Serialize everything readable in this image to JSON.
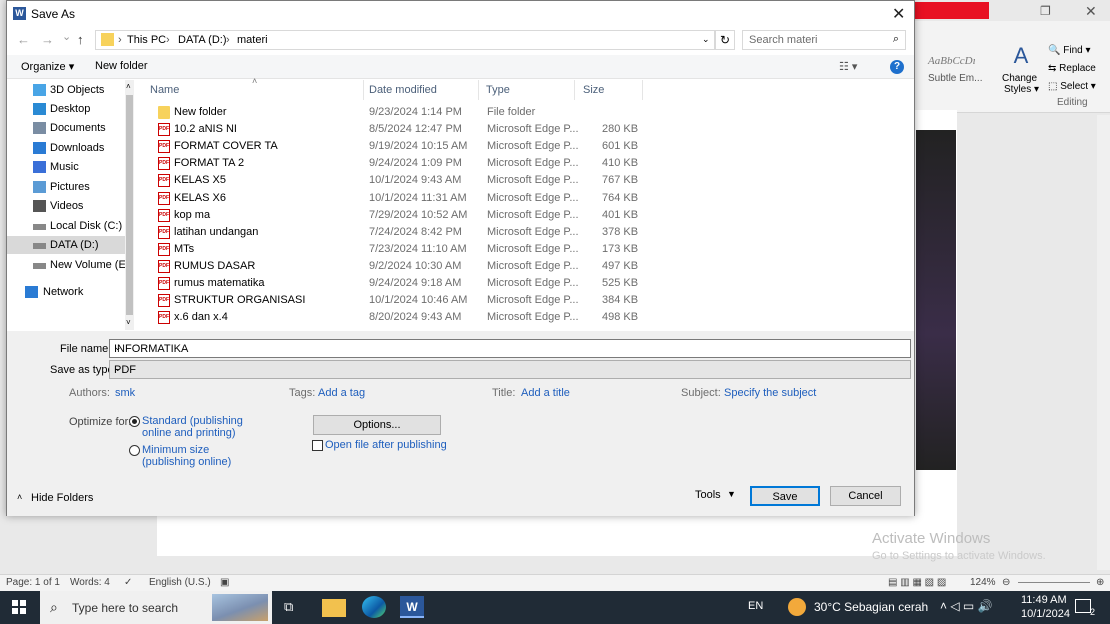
{
  "dialog": {
    "title": "Save As",
    "nav": {
      "back": "←",
      "forward": "→",
      "recent": "⌄",
      "up": "↑",
      "breadcrumb": [
        "This PC",
        "DATA (D:)",
        "materi"
      ],
      "separator": "›",
      "refresh": "↻",
      "search_placeholder": "Search materi"
    },
    "toolbar": {
      "organize": "Organize ▾",
      "new_folder": "New folder",
      "view": "☷ ▾",
      "help": "?"
    },
    "sidebar": [
      {
        "label": "3D Objects",
        "icon": "cube-icon",
        "selected": false
      },
      {
        "label": "Desktop",
        "icon": "desktop-icon",
        "selected": false
      },
      {
        "label": "Documents",
        "icon": "document-icon",
        "selected": false
      },
      {
        "label": "Downloads",
        "icon": "download-icon",
        "selected": false
      },
      {
        "label": "Music",
        "icon": "music-icon",
        "selected": false
      },
      {
        "label": "Pictures",
        "icon": "pictures-icon",
        "selected": false
      },
      {
        "label": "Videos",
        "icon": "video-icon",
        "selected": false
      },
      {
        "label": "Local Disk (C:)",
        "icon": "drive-icon",
        "selected": false
      },
      {
        "label": "DATA (D:)",
        "icon": "drive-icon",
        "selected": true
      },
      {
        "label": "New Volume (E:)",
        "icon": "drive-icon",
        "selected": false
      },
      {
        "label": "Network",
        "icon": "network-icon",
        "selected": false
      }
    ],
    "columns": [
      "Name",
      "Date modified",
      "Type",
      "Size"
    ],
    "files": [
      {
        "name": "New folder",
        "date": "9/23/2024 1:14 PM",
        "type": "File folder",
        "size": "",
        "icon": "folder-icon"
      },
      {
        "name": "10.2 aNIS NI",
        "date": "8/5/2024 12:47 PM",
        "type": "Microsoft Edge P...",
        "size": "280 KB",
        "icon": "pdf-icon"
      },
      {
        "name": "FORMAT COVER TA",
        "date": "9/19/2024 10:15 AM",
        "type": "Microsoft Edge P...",
        "size": "601 KB",
        "icon": "pdf-icon"
      },
      {
        "name": "FORMAT TA 2",
        "date": "9/24/2024 1:09 PM",
        "type": "Microsoft Edge P...",
        "size": "410 KB",
        "icon": "pdf-icon"
      },
      {
        "name": "KELAS X5",
        "date": "10/1/2024 9:43 AM",
        "type": "Microsoft Edge P...",
        "size": "767 KB",
        "icon": "pdf-icon"
      },
      {
        "name": "KELAS X6",
        "date": "10/1/2024 11:31 AM",
        "type": "Microsoft Edge P...",
        "size": "764 KB",
        "icon": "pdf-icon"
      },
      {
        "name": "kop ma",
        "date": "7/29/2024 10:52 AM",
        "type": "Microsoft Edge P...",
        "size": "401 KB",
        "icon": "pdf-icon"
      },
      {
        "name": "latihan undangan",
        "date": "7/24/2024 8:42 PM",
        "type": "Microsoft Edge P...",
        "size": "378 KB",
        "icon": "pdf-icon"
      },
      {
        "name": "MTs",
        "date": "7/23/2024 11:10 AM",
        "type": "Microsoft Edge P...",
        "size": "173 KB",
        "icon": "pdf-icon"
      },
      {
        "name": "RUMUS DASAR",
        "date": "9/2/2024 10:30 AM",
        "type": "Microsoft Edge P...",
        "size": "497 KB",
        "icon": "pdf-icon"
      },
      {
        "name": "rumus matematika",
        "date": "9/24/2024 9:18 AM",
        "type": "Microsoft Edge P...",
        "size": "525 KB",
        "icon": "pdf-icon"
      },
      {
        "name": "STRUKTUR ORGANISASI",
        "date": "10/1/2024 10:46 AM",
        "type": "Microsoft Edge P...",
        "size": "384 KB",
        "icon": "pdf-icon"
      },
      {
        "name": "x.6 dan x.4",
        "date": "8/20/2024 9:43 AM",
        "type": "Microsoft Edge P...",
        "size": "498 KB",
        "icon": "pdf-icon"
      }
    ],
    "form": {
      "file_name_label": "File name:",
      "file_name_value": "INFORMATIKA",
      "save_type_label": "Save as type:",
      "save_type_value": "PDF",
      "authors_label": "Authors:",
      "authors_value": "smk",
      "tags_label": "Tags:",
      "tags_value": "Add a tag",
      "title_label": "Title:",
      "title_value": "Add a title",
      "subject_label": "Subject:",
      "subject_value": "Specify the subject",
      "optimize_label": "Optimize for:",
      "opt_standard_1": "Standard (publishing",
      "opt_standard_2": "online and printing)",
      "opt_minimum_1": "Minimum size",
      "opt_minimum_2": "(publishing online)",
      "options_button": "Options...",
      "open_after": "Open file after publishing",
      "hide_folders": "Hide Folders",
      "tools": "Tools",
      "save": "Save",
      "cancel": "Cancel"
    }
  },
  "word": {
    "ribbon": {
      "style_preview": "AaBbCcDı",
      "style_name": "Subtle Em...",
      "change_styles_1": "Change",
      "change_styles_2": "Styles ▾",
      "find": "Find ▾",
      "replace": "Replace",
      "select": "Select ▾",
      "group": "Editing"
    },
    "statusbar": {
      "page": "Page: 1 of 1",
      "words": "Words: 4",
      "language": "English (U.S.)",
      "zoom": "124%"
    },
    "activate_title": "Activate Windows",
    "activate_sub": "Go to Settings to activate Windows."
  },
  "taskbar": {
    "search_placeholder": "Type here to search",
    "language": "EN",
    "weather": "30°C  Sebagian cerah",
    "time": "11:49 AM",
    "date": "10/1/2024",
    "notifications": "2"
  }
}
